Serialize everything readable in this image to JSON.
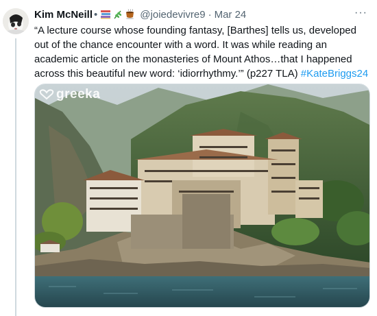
{
  "tweet": {
    "author_name": "Kim McNeill",
    "separator": "•",
    "handle": "@joiedevivre9",
    "date_separator": "·",
    "date": "Mar 24",
    "more_label": "···",
    "text_main": "“A lecture course whose founding fantasy, [Barthes] tells us, developed out of the chance encounter with a word. It was while reading an academic article on the monasteries of Mount Athos…that I happened across this beautiful new word: ‘idiorrhythmy.’” (p227 TLA)",
    "hashtag": "#KateBriggs24",
    "emoji_names": [
      "books-emoji",
      "herb-emoji",
      "hot-beverage-emoji"
    ]
  },
  "media": {
    "watermark": "greeka"
  },
  "colors": {
    "hashtag": "#1d9bf0",
    "secondary_text": "#536471",
    "border": "#cfd9de"
  }
}
